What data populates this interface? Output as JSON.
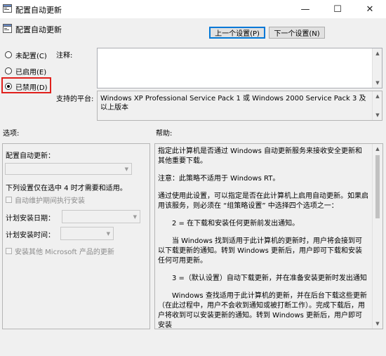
{
  "window": {
    "title": "配置自动更新",
    "minimize_glyph": "—",
    "maximize_glyph": "☐",
    "close_glyph": "✕"
  },
  "header": {
    "policy_name": "配置自动更新",
    "prev_label": "上一个设置(P)",
    "next_label": "下一个设置(N)"
  },
  "state": {
    "options": [
      {
        "label": "未配置(C)",
        "checked": false
      },
      {
        "label": "已启用(E)",
        "checked": false
      },
      {
        "label": "已禁用(D)",
        "checked": true
      }
    ]
  },
  "comment": {
    "label": "注释:",
    "value": ""
  },
  "platform": {
    "label": "支持的平台:",
    "value": "Windows XP Professional Service Pack 1 或 Windows 2000 Service Pack 3 及以上版本"
  },
  "options_section": {
    "label": "选项:",
    "configure_label": "配置自动更新：",
    "install_note": "下列设置仅在选中 4 时才需要和适用。",
    "maintenance_label": "自动维护期间执行安装",
    "schedule_day_label": "计划安装日期：",
    "schedule_time_label": "计划安装时间：",
    "ms_products_label": "安装其他 Microsoft 产品的更新"
  },
  "help_section": {
    "label": "帮助:",
    "paragraphs": [
      "指定此计算机是否通过 Windows 自动更新服务来接收安全更新和其他重要下载。",
      "注意：此策略不适用于 Windows RT。",
      "通过使用此设置，可以指定是否在此计算机上启用自动更新。如果启用该服务，则必须在 “组策略设置” 中选择四个选项之一：",
      "2 = 在下载和安装任何更新前发出通知。",
      "当 Windows 找到适用于此计算机的更新时，用户将会接到可以下载更新的通知。转到 Windows 更新后，用户即可下载和安装任何可用更新。",
      "3 =（默认设置）自动下载更新，并在准备安装更新时发出通知",
      "Windows 查找适用于此计算机的更新，并在后台下载这些更新（在此过程中，用户不会收到通知或被打断工作）。完成下载后，用户将收到可以安装更新的通知。转到 Windows 更新后，用户即可安装"
    ]
  },
  "colors": {
    "highlight_box": "#e0201c",
    "focus_border": "#0078d7"
  }
}
